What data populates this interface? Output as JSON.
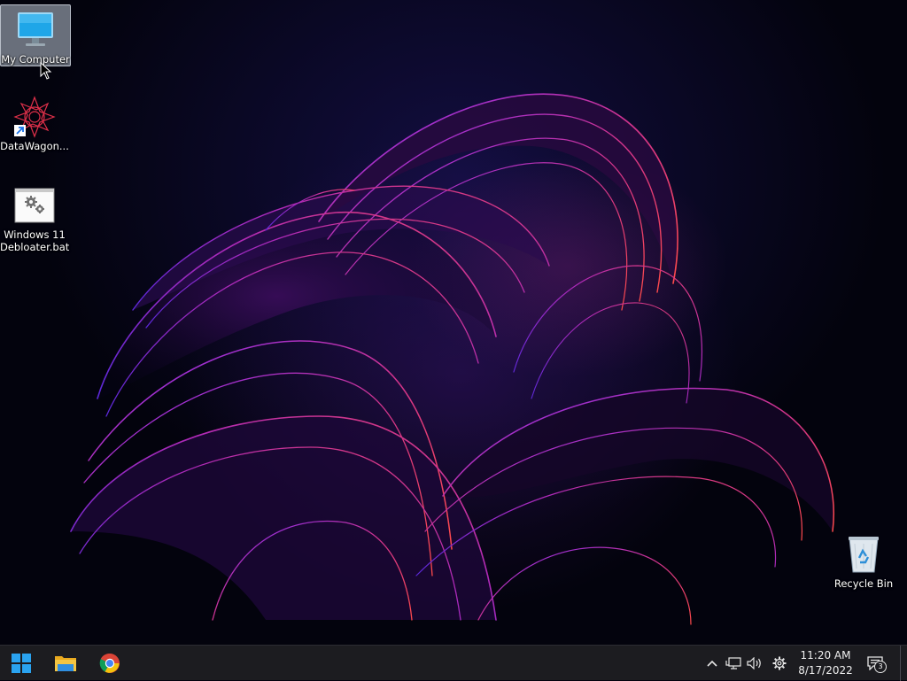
{
  "desktop": {
    "icons": [
      {
        "label": "My Computer",
        "icon": "monitor-icon",
        "selected": true
      },
      {
        "label": "DataWagon...",
        "icon": "datawagon-shortcut-icon"
      },
      {
        "label": "Windows 11 Debloater.bat",
        "icon": "batch-file-icon"
      },
      {
        "label": "Recycle Bin",
        "icon": "recycle-bin-icon"
      }
    ]
  },
  "taskbar": {
    "pinned": [
      {
        "name": "Start",
        "icon": "windows-logo-icon"
      },
      {
        "name": "File Explorer",
        "icon": "folder-icon"
      },
      {
        "name": "Google Chrome",
        "icon": "chrome-icon"
      }
    ],
    "tray": {
      "icons": [
        "chevron-up-icon",
        "network-icon",
        "volume-icon",
        "settings-gear-icon"
      ],
      "time": "11:20 AM",
      "date": "8/17/2022",
      "notification_count": "3"
    }
  },
  "colors": {
    "taskbar_bg": "#1c1c20",
    "windows_blue": "#2aa3f0",
    "folder_yellow": "#f4c542"
  }
}
